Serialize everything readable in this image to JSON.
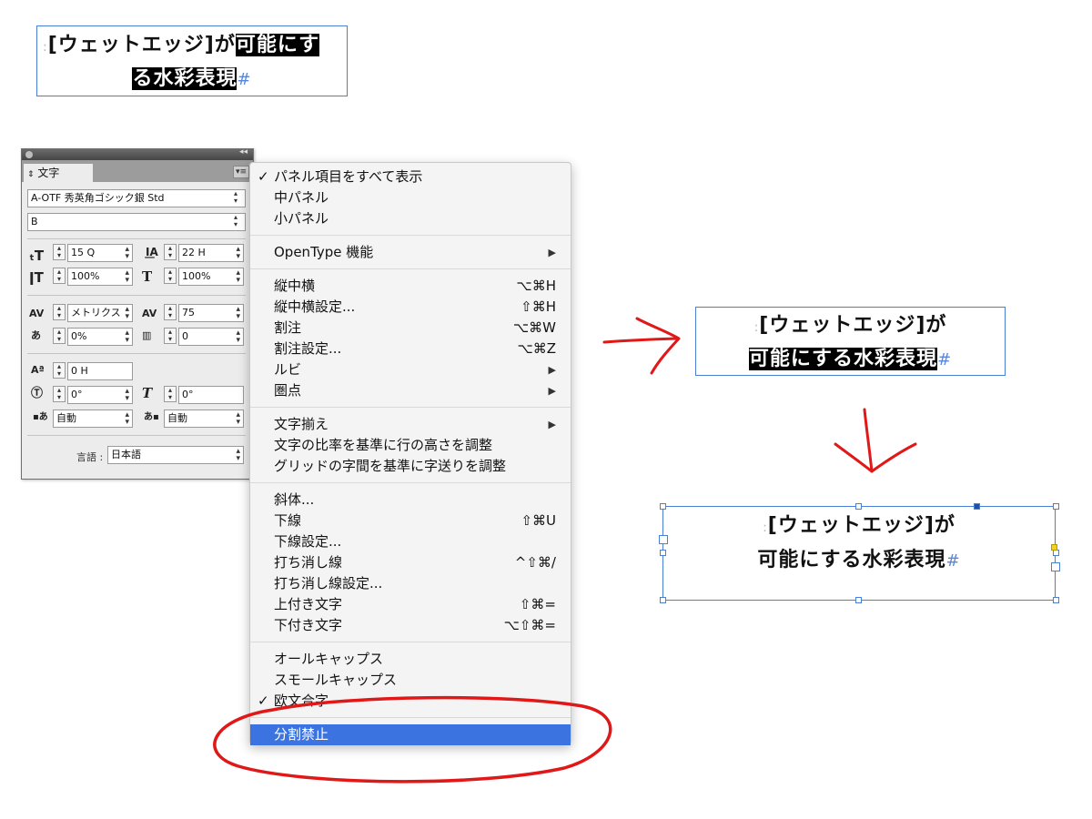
{
  "frames": {
    "top": {
      "bracket": "[ウェットエッジ]",
      "ga": "が",
      "hl1": "可能にす",
      "hl2": "る水彩表現",
      "end_mark": "#"
    },
    "mid": {
      "line1": "[ウェットエッジ]が",
      "hl": "可能にする水彩表現",
      "end_mark": "#"
    },
    "bottom": {
      "line1": "[ウェットエッジ]が",
      "line2": "可能にする水彩表現",
      "end_mark": "#"
    }
  },
  "panel": {
    "tab_label": "文字",
    "font_family": "A-OTF 秀英角ゴシック銀 Std",
    "font_style": "B",
    "font_size": "15 Q",
    "leading": "22 H",
    "vertical_scale": "100%",
    "horizontal_scale": "100%",
    "kerning": "メトリクス",
    "tracking": "75",
    "tsume": "0%",
    "aki": "0",
    "baseline_shift": "0 H",
    "rotation": "0°",
    "skew": "0°",
    "aki_before": "自動",
    "aki_after": "自動",
    "language_label": "言語 :",
    "language": "日本語"
  },
  "menu": {
    "sections": [
      [
        {
          "label": "パネル項目をすべて表示",
          "checked": true
        },
        {
          "label": "中パネル"
        },
        {
          "label": "小パネル"
        }
      ],
      [
        {
          "label": "OpenType 機能",
          "submenu": true
        }
      ],
      [
        {
          "label": "縦中横",
          "shortcut": "⌥⌘H"
        },
        {
          "label": "縦中横設定...",
          "shortcut": "⇧⌘H"
        },
        {
          "label": "割注",
          "shortcut": "⌥⌘W"
        },
        {
          "label": "割注設定...",
          "shortcut": "⌥⌘Z"
        },
        {
          "label": "ルビ",
          "submenu": true
        },
        {
          "label": "圏点",
          "submenu": true
        }
      ],
      [
        {
          "label": "文字揃え",
          "submenu": true
        },
        {
          "label": "文字の比率を基準に行の高さを調整"
        },
        {
          "label": "グリッドの字間を基準に字送りを調整"
        }
      ],
      [
        {
          "label": "斜体..."
        },
        {
          "label": "下線",
          "shortcut": "⇧⌘U"
        },
        {
          "label": "下線設定..."
        },
        {
          "label": "打ち消し線",
          "shortcut": "^⇧⌘/"
        },
        {
          "label": "打ち消し線設定..."
        },
        {
          "label": "上付き文字",
          "shortcut": "⇧⌘="
        },
        {
          "label": "下付き文字",
          "shortcut": "⌥⇧⌘="
        }
      ],
      [
        {
          "label": "オールキャップス"
        },
        {
          "label": "スモールキャップス"
        },
        {
          "label": "欧文合字",
          "checked": true
        }
      ],
      [
        {
          "label": "分割禁止",
          "selected": true
        }
      ]
    ]
  },
  "colors": {
    "accent": "#3b73e0",
    "frame_border": "#4a7fd6",
    "annotation": "#e01818",
    "highlight_bg": "#000000"
  }
}
